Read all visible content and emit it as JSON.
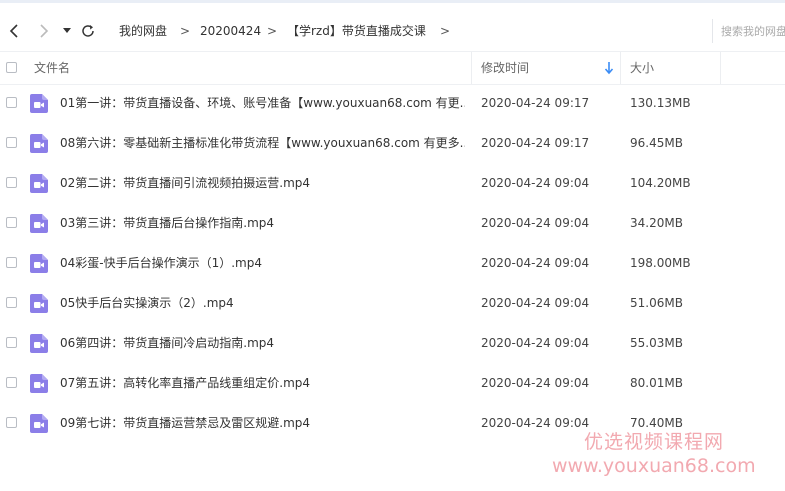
{
  "breadcrumb": {
    "items": [
      "我的网盘",
      "20200424",
      "【学rzd】带货直播成交课"
    ],
    "separator": ">"
  },
  "search": {
    "placeholder": "搜索我的网盘"
  },
  "columns": {
    "name": "文件名",
    "time": "修改时间",
    "size": "大小"
  },
  "files": [
    {
      "name": "01第一讲：带货直播设备、环境、账号准备【www.youxuan68.com 有更...",
      "time": "2020-04-24 09:17",
      "size": "130.13MB"
    },
    {
      "name": "08第六讲：零基础新主播标准化带货流程【www.youxuan68.com 有更多...",
      "time": "2020-04-24 09:17",
      "size": "96.45MB"
    },
    {
      "name": "02第二讲：带货直播间引流视频拍摄运营.mp4",
      "time": "2020-04-24 09:04",
      "size": "104.20MB"
    },
    {
      "name": "03第三讲：带货直播后台操作指南.mp4",
      "time": "2020-04-24 09:04",
      "size": "34.20MB"
    },
    {
      "name": "04彩蛋-快手后台操作演示（1）.mp4",
      "time": "2020-04-24 09:04",
      "size": "198.00MB"
    },
    {
      "name": "05快手后台实操演示（2）.mp4",
      "time": "2020-04-24 09:04",
      "size": "51.06MB"
    },
    {
      "name": "06第四讲：带货直播间冷启动指南.mp4",
      "time": "2020-04-24 09:04",
      "size": "55.03MB"
    },
    {
      "name": "07第五讲：高转化率直播产品线重组定价.mp4",
      "time": "2020-04-24 09:04",
      "size": "80.01MB"
    },
    {
      "name": "09第七讲：带货直播运营禁忌及雷区规避.mp4",
      "time": "2020-04-24 09:04",
      "size": "70.40MB"
    }
  ],
  "watermark": {
    "line1": "优选视频课程网",
    "line2": "www.youxuan68.com"
  },
  "colors": {
    "accent": "#3b8cf5",
    "video_icon": "#8b7ee8"
  }
}
